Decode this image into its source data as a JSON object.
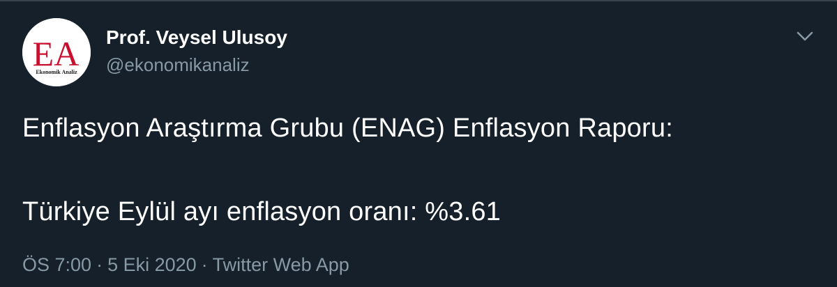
{
  "author": {
    "name": "Prof. Veysel Ulusoy",
    "handle": "@ekonomikanaliz",
    "avatar_icon": "ekonomik-analiz-logo",
    "avatar_logo_text": "EA",
    "avatar_caption": "Ekonomik Analiz"
  },
  "tweet": {
    "line1": "Enflasyon Araştırma Grubu (ENAG) Enflasyon Raporu:",
    "line2": "Türkiye Eylül ayı enflasyon oranı: %3.61"
  },
  "meta": {
    "time": "ÖS 7:00",
    "date": "5 Eki 2020",
    "source": "Twitter Web App",
    "separator": "·"
  },
  "colors": {
    "background": "#15202b",
    "text_primary": "#ffffff",
    "text_secondary": "#8899a6",
    "logo_red": "#c8102e"
  }
}
